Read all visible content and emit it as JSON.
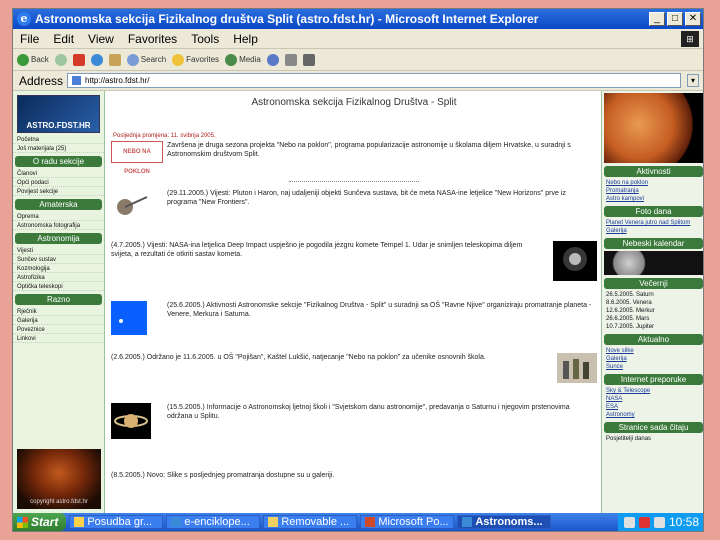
{
  "window": {
    "title": "Astronomska sekcija Fizikalnog društva Split (astro.fdst.hr) - Microsoft Internet Explorer"
  },
  "menu": [
    "File",
    "Edit",
    "View",
    "Favorites",
    "Tools",
    "Help"
  ],
  "toolbar": {
    "back": "Back",
    "search": "Search",
    "favorites": "Favorites",
    "media": "Media"
  },
  "address": {
    "label": "Address",
    "url": "http://astro.fdst.hr/"
  },
  "site": {
    "logo": "ASTRO.FDST.HR",
    "title": "Astronomska sekcija Fizikalnog Društva - Split",
    "copyright": "copyright astro.fdst.hr",
    "headline": "Posljednja promjena: 11. svibnja 2005.",
    "nebeski": "NEBO NA POKLON"
  },
  "leftnav": [
    {
      "head": "",
      "items": [
        "Početna",
        "Još materijala (25)"
      ]
    },
    {
      "head": "O radu sekcije",
      "items": [
        "Članovi",
        "Opći podaci",
        "Povijest sekcije"
      ]
    },
    {
      "head": "Amaterska",
      "items": [
        "Oprema",
        "Astronomska fotografija"
      ]
    },
    {
      "head": "Astronomija",
      "items": [
        "Vijesti",
        "Sunčev sustav",
        "Kozmologija",
        "Astrofizika",
        "Optička teleskopi"
      ]
    },
    {
      "head": "Razno",
      "items": [
        "Rječnik",
        "Galerija",
        "Poveznice",
        "Linkovi"
      ]
    }
  ],
  "news": [
    "Završena je druga sezona projekta \"Nebo na poklon\", programa popularizacije astronomije u školama diljem Hrvatske, u suradnji s Astronomskim društvom Split.",
    "(29.11.2005.) Vijesti: Pluton i Haron, naj udaljeniji objekti Sunčeva sustava, bit će meta NASA-ine letjelice \"New Horizons\" prve iz programa \"New Frontiers\".",
    "(4.7.2005.) Vijesti: NASA-ina letjelica Deep Impact uspješno je pogodila jezgru komete Tempel 1. Udar je snimljen teleskopima diljem svijeta, a rezultati će otkriti sastav kometa.",
    "(25.6.2005.) Aktivnosti Astronomske sekcije \"Fizikalnog Društva - Split\" u suradnji sa OŠ \"Ravne Njive\" organiziraju promatranje planeta - Venere, Merkura i Saturna.",
    "(2.6.2005.) Održano je 11.6.2005. u OŠ \"Pojišan\", Kaštel Lukšić, natjecanje \"Nebo na poklon\" za učenike osnovnih škola.",
    "(15.5.2005.) Informacije o Astronomskoj ljetnoj školi i \"Svjetskom danu astronomije\", predavanja o Saturnu i njegovim prstenovima održana u Splitu.",
    "(8.5.2005.) Novo: Slike s posljednjeg promatranja dostupne su u galeriji."
  ],
  "right": {
    "aktivnosti_head": "Aktivnosti",
    "aktivnosti": [
      "Nebo na poklon",
      "Promatranja",
      "Astro kampovi"
    ],
    "foto_head": "Foto dana",
    "foto": [
      "Planet Venera jutro nad Splitom",
      "Galerija"
    ],
    "kalendar_head": "Nebeski kalendar",
    "kalendar": [
      "Mjesec - faze"
    ],
    "vecernji_head": "Večernji",
    "vecernji": [
      "26.5.2005. Saturn",
      "8.6.2005. Venera",
      "12.6.2005. Merkur",
      "26.6.2005. Mars",
      "10.7.2005. Jupiter"
    ],
    "aktualno_head": "Aktualno",
    "aktualno": [
      "Nove slike",
      "Galerija",
      "Sunce"
    ],
    "preporuke_head": "Internet preporuke",
    "preporuke": [
      "Sky & Telescope",
      "NASA",
      "ESA",
      "Astronomy"
    ],
    "stranice_head": "Stranice sada čitaju",
    "stranice": [
      "Posjetitelji danas"
    ]
  },
  "taskbar": {
    "start": "Start",
    "tasks": [
      "Posudba gr...",
      "e-enciklope...",
      "Removable ...",
      "Microsoft Po...",
      "Astronoms..."
    ],
    "clock": "10:58"
  }
}
